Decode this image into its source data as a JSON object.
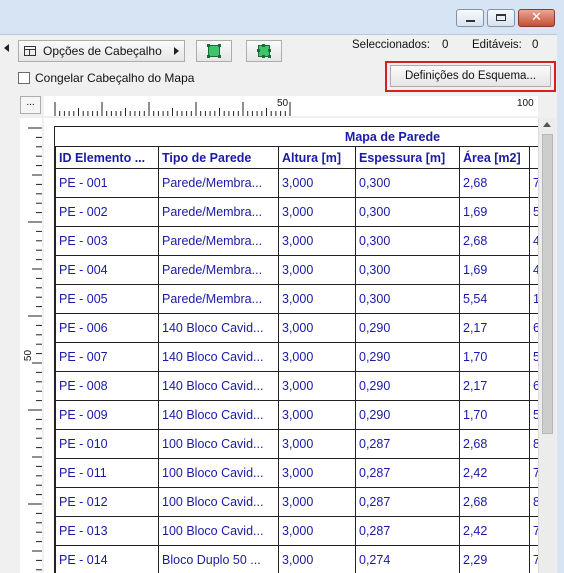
{
  "window": {
    "controls": {
      "minimize": "minimize-icon",
      "maximize": "maximize-icon",
      "close": "✕"
    }
  },
  "toolbar": {
    "header_options_label": "Opções de Cabeçalho",
    "selected_label": "Seleccionados:",
    "selected_value": "0",
    "editable_label": "Editáveis:",
    "editable_value": "0",
    "freeze_label": "Congelar Cabeçalho do Mapa",
    "freeze_checked": false,
    "schema_settings_label": "Definições do Esquema...",
    "highlight_color": "#d32020"
  },
  "ruler": {
    "corner_label": "...",
    "top_labels": [
      "50",
      "100"
    ],
    "left_labels": [
      "50"
    ]
  },
  "schedule": {
    "title": "Mapa de Parede",
    "text_color": "#1a1aa6",
    "headers": [
      "ID Elemento ...",
      "Tipo de Parede",
      "Altura [m]",
      "Espessura [m]",
      "Área [m2]"
    ],
    "rows": [
      [
        "PE - 001",
        "Parede/Membra...",
        "3,000",
        "0,300",
        "2,68"
      ],
      [
        "PE - 002",
        "Parede/Membra...",
        "3,000",
        "0,300",
        "1,69"
      ],
      [
        "PE - 003",
        "Parede/Membra...",
        "3,000",
        "0,300",
        "2,68"
      ],
      [
        "PE - 004",
        "Parede/Membra...",
        "3,000",
        "0,300",
        "1,69"
      ],
      [
        "PE - 005",
        "Parede/Membra...",
        "3,000",
        "0,300",
        "5,54"
      ],
      [
        "PE - 006",
        "140 Bloco Cavid...",
        "3,000",
        "0,290",
        "2,17"
      ],
      [
        "PE - 007",
        "140 Bloco Cavid...",
        "3,000",
        "0,290",
        "1,70"
      ],
      [
        "PE - 008",
        "140 Bloco Cavid...",
        "3,000",
        "0,290",
        "2,17"
      ],
      [
        "PE - 009",
        "140 Bloco Cavid...",
        "3,000",
        "0,290",
        "1,70"
      ],
      [
        "PE - 010",
        "100 Bloco Cavid...",
        "3,000",
        "0,287",
        "2,68"
      ],
      [
        "PE - 011",
        "100 Bloco Cavid...",
        "3,000",
        "0,287",
        "2,42"
      ],
      [
        "PE - 012",
        "100 Bloco Cavid...",
        "3,000",
        "0,287",
        "2,68"
      ],
      [
        "PE - 013",
        "100 Bloco Cavid...",
        "3,000",
        "0,287",
        "2,42"
      ],
      [
        "PE - 014",
        "Bloco Duplo 50 ...",
        "3,000",
        "0,274",
        "2,29"
      ]
    ],
    "clipped_last_column": [
      "7",
      "5",
      "4",
      "4",
      "1",
      "6",
      "5",
      "6",
      "5",
      "8",
      "7",
      "8",
      "7",
      "7"
    ]
  }
}
